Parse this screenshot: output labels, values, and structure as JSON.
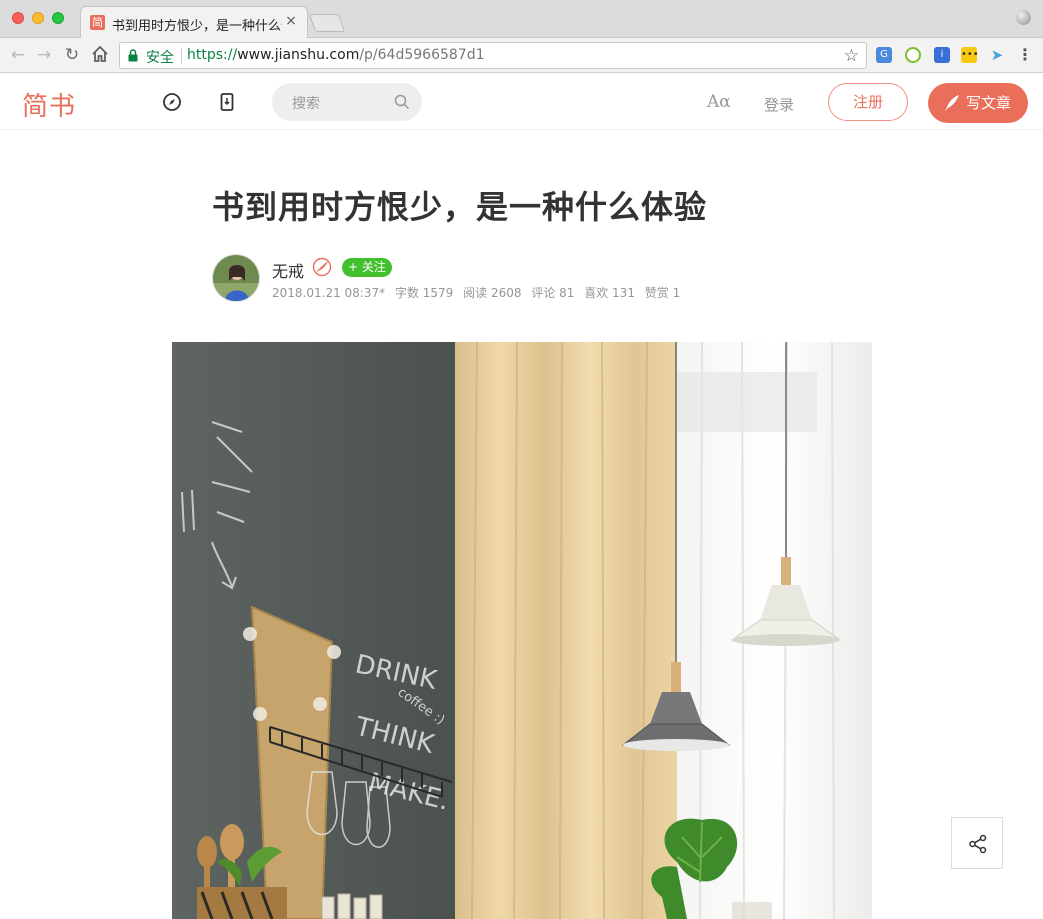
{
  "browser": {
    "tab_title": "书到用时方恨少，是一种什么体",
    "tab_favicon": "简",
    "tab_close": "×",
    "secure_label": "安全",
    "url_scheme": "https://",
    "url_host": "www.jianshu.com",
    "url_path": "/p/64d5966587d1",
    "icons": [
      "back-icon",
      "forward-icon",
      "reload-icon",
      "home-icon",
      "lock-icon",
      "star-icon",
      "menu-icon"
    ]
  },
  "site": {
    "logo": "简书",
    "search_placeholder": "搜索",
    "font_toggle": "Aα",
    "login": "登录",
    "register": "注册",
    "write": "写文章",
    "accent_color": "#ea6f5a"
  },
  "article": {
    "title": "书到用时方恨少，是一种什么体验",
    "author": "无戒",
    "follow": "+ 关注",
    "date": "2018.01.21 08:37*",
    "word_count": "字数 1579",
    "reads": "阅读 2608",
    "comments": "评论 81",
    "likes": "喜欢 131",
    "rewards": "赞赏 1",
    "hero_chalk_text": [
      "DRINK",
      "coffee :)",
      "THINK",
      "MAKE."
    ]
  }
}
